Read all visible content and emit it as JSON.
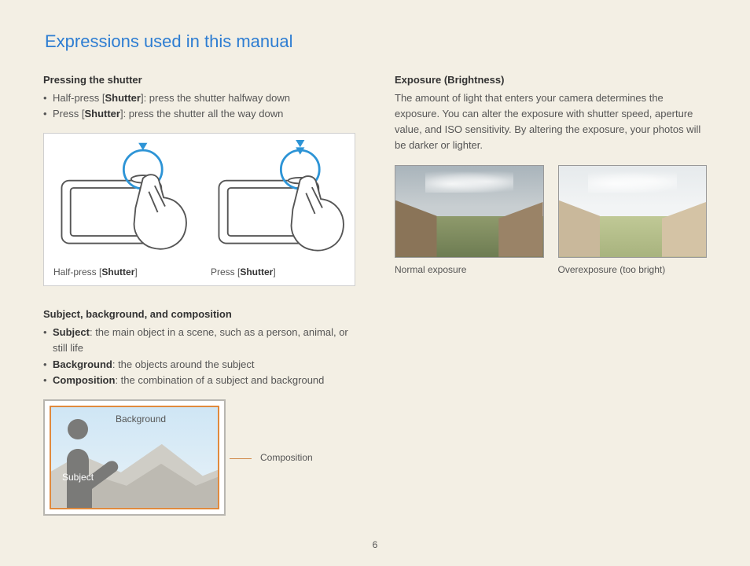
{
  "page_number": "6",
  "title": "Expressions used in this manual",
  "left": {
    "shutter": {
      "heading": "Pressing the shutter",
      "items": [
        {
          "prefix": "Half-press [",
          "bold": "Shutter",
          "suffix": "]: press the shutter halfway down"
        },
        {
          "prefix": "Press [",
          "bold": "Shutter",
          "suffix": "]: press the shutter all the way down"
        }
      ],
      "captions": {
        "half_prefix": "Half-press [",
        "half_bold": "Shutter",
        "half_suffix": "]",
        "full_prefix": "Press [",
        "full_bold": "Shutter",
        "full_suffix": "]"
      }
    },
    "composition": {
      "heading": "Subject, background, and composition",
      "items": [
        {
          "bold": "Subject",
          "suffix": ": the main object in a scene, such as a person, animal, or still life"
        },
        {
          "bold": "Background",
          "suffix": ": the objects around the subject"
        },
        {
          "bold": "Composition",
          "suffix": ": the combination of a subject and background"
        }
      ],
      "labels": {
        "background": "Background",
        "subject": "Subject",
        "composition": "Composition"
      }
    }
  },
  "right": {
    "exposure": {
      "heading": "Exposure (Brightness)",
      "body": "The amount of light that enters your camera determines the exposure. You can alter the exposure with shutter speed, aperture value, and ISO sensitivity. By altering the exposure, your photos will be darker or lighter.",
      "captions": {
        "normal": "Normal exposure",
        "over": "Overexposure (too bright)"
      }
    }
  }
}
